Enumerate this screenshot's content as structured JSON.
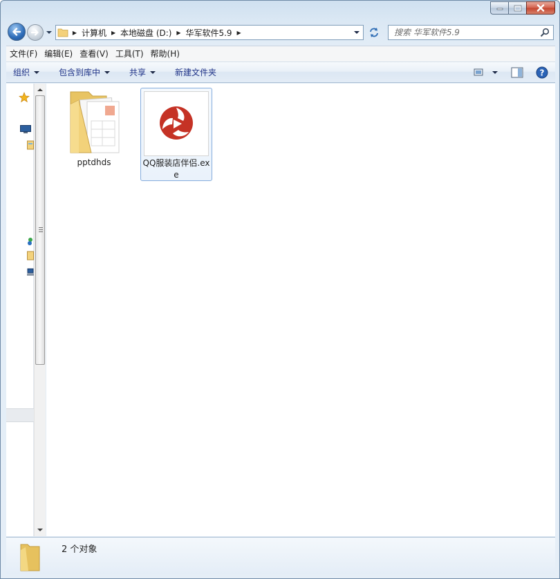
{
  "window": {
    "caption_buttons": [
      "minimize",
      "maximize",
      "close"
    ]
  },
  "nav": {
    "breadcrumbs": [
      "计算机",
      "本地磁盘 (D:)",
      "华军软件5.9"
    ],
    "search_placeholder": "搜索 华军软件5.9"
  },
  "menubar": {
    "items": [
      "文件(F)",
      "编辑(E)",
      "查看(V)",
      "工具(T)",
      "帮助(H)"
    ]
  },
  "commandbar": {
    "organize": "组织",
    "include_in_library": "包含到库中",
    "share": "共享",
    "new_folder": "新建文件夹"
  },
  "files": [
    {
      "name": "pptdhds",
      "type": "folder",
      "icon": "folder-icon",
      "selected": false
    },
    {
      "name": "QQ服装店伴侣.exe",
      "type": "exe",
      "icon": "app-logo-icon",
      "selected": true
    }
  ],
  "details": {
    "count_text": "2 个对象"
  },
  "colors": {
    "accent": "#1e3287",
    "selection_border": "#84acdd",
    "logo_red": "#c0392b"
  }
}
